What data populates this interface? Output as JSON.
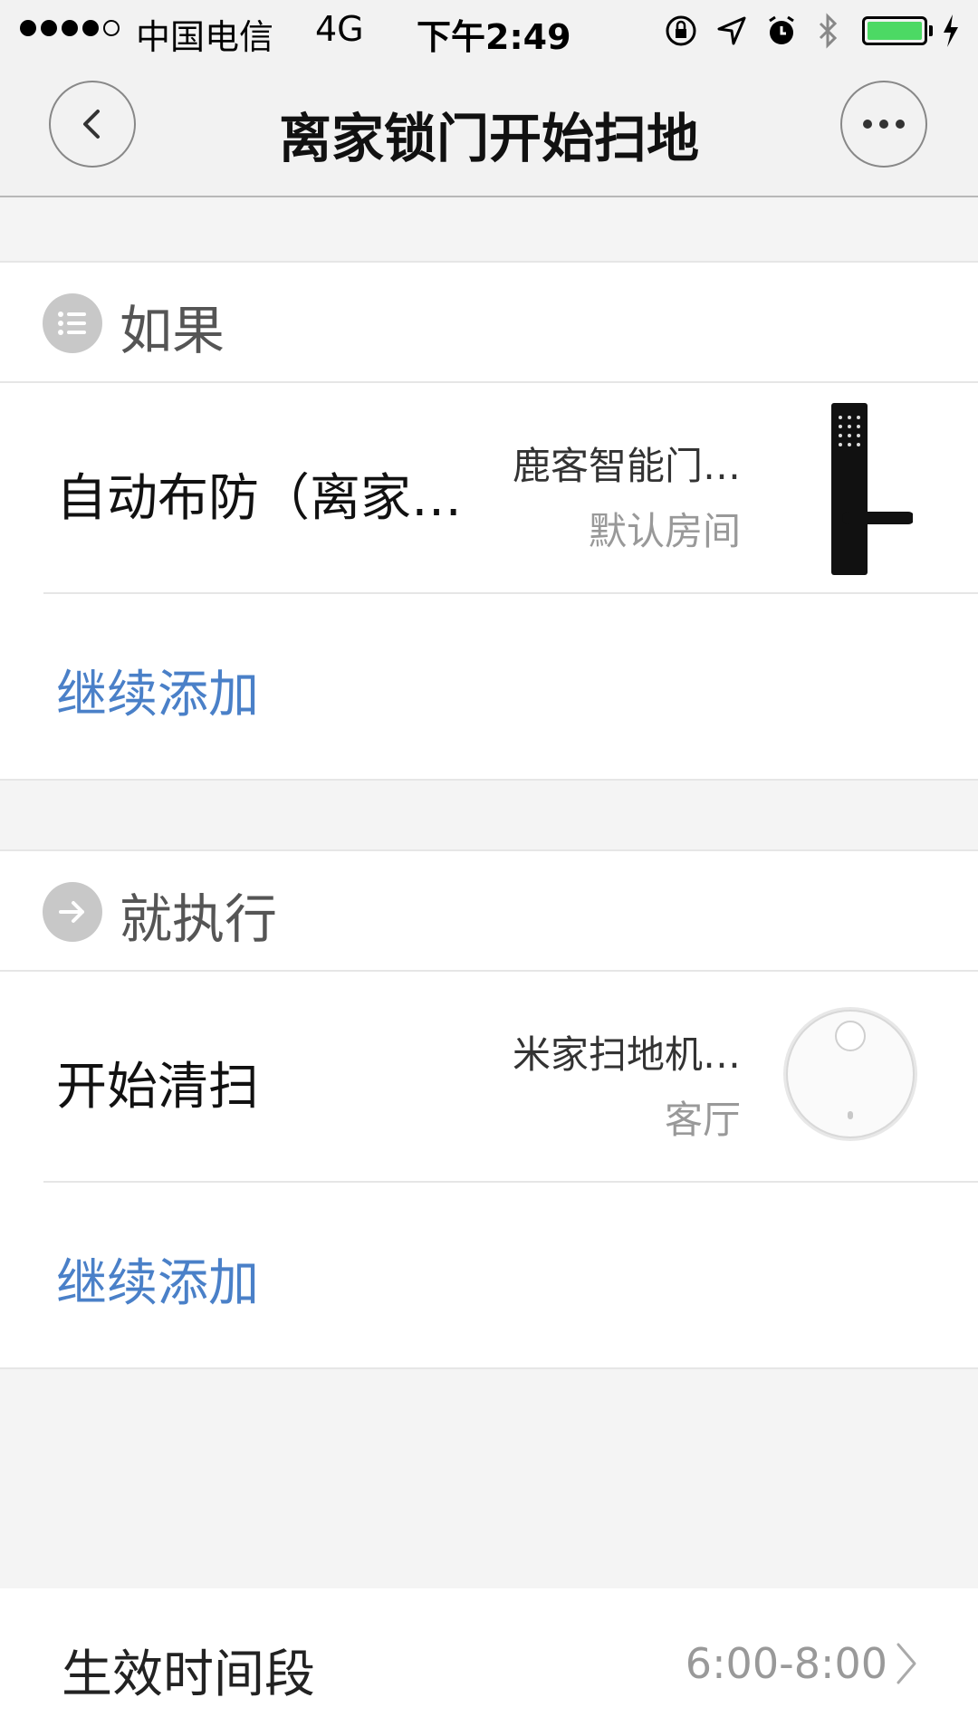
{
  "status_bar": {
    "carrier": "中国电信",
    "network": "4G",
    "time": "下午2:49",
    "battery_color": "#4cd964"
  },
  "nav": {
    "title": "离家锁门开始扫地",
    "back_icon": "chevron-left-icon",
    "more_icon": "more-dots-icon"
  },
  "if_section": {
    "label": "如果",
    "icon": "list-icon",
    "items": [
      {
        "title": "自动布防（离家…",
        "device": "鹿客智能门…",
        "room": "默认房间",
        "image": "smart-lock-image"
      }
    ],
    "add_label": "继续添加"
  },
  "then_section": {
    "label": "就执行",
    "icon": "arrow-right-icon",
    "items": [
      {
        "title": "开始清扫",
        "device": "米家扫地机…",
        "room": "客厅",
        "image": "robot-vacuum-image"
      }
    ],
    "add_label": "继续添加"
  },
  "effective_time": {
    "label": "生效时间段",
    "value": "6:00-8:00"
  },
  "colors": {
    "accent_link": "#4a80c8",
    "background": "#f4f4f4"
  }
}
